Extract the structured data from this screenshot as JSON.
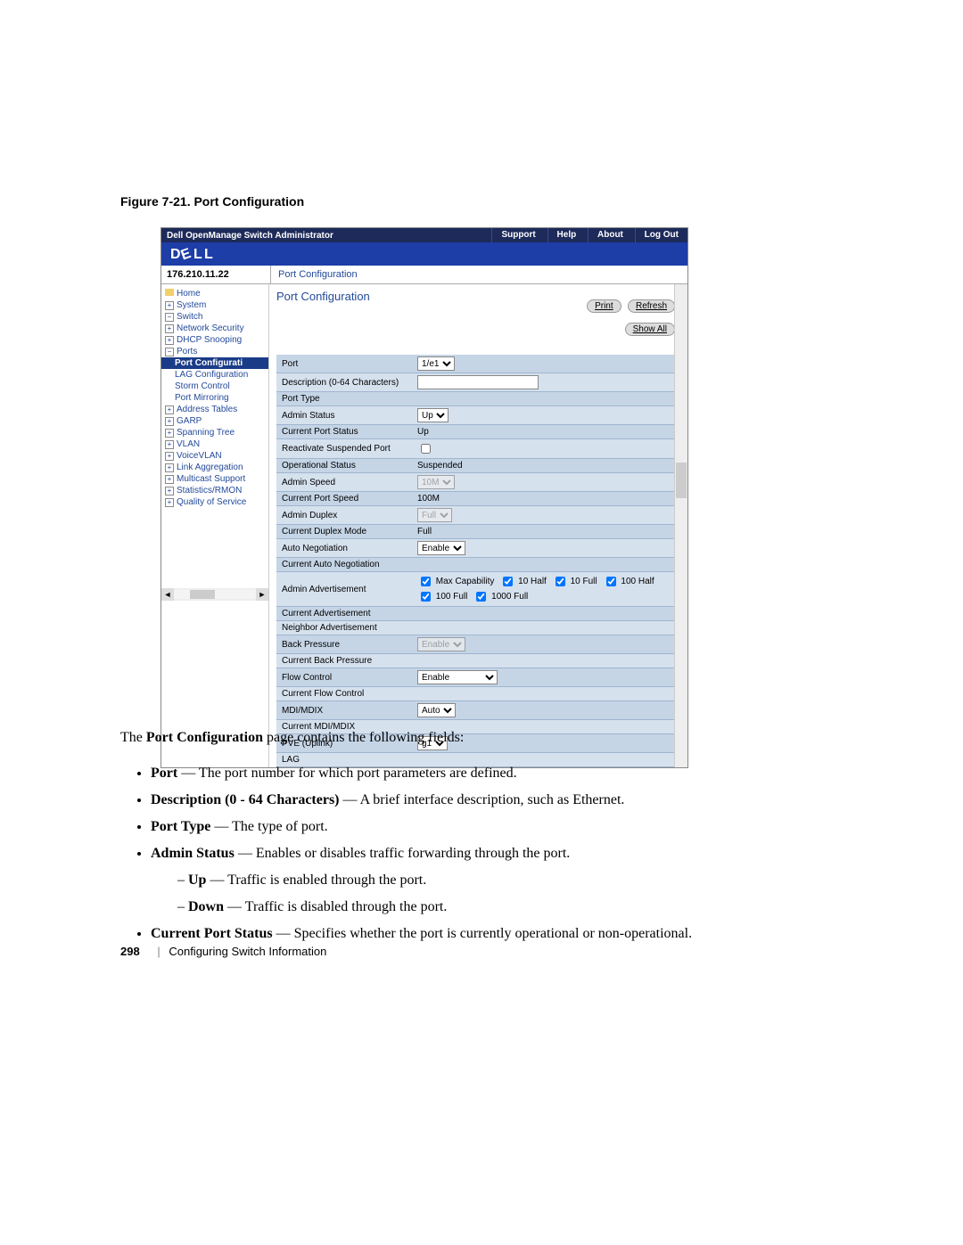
{
  "figure_caption": "Figure 7-21.    Port Configuration",
  "topbar": {
    "title": "Dell OpenManage Switch Administrator",
    "links": [
      "Support",
      "Help",
      "About",
      "Log Out"
    ]
  },
  "ip": "176.210.11.22",
  "breadcrumb": "Port Configuration",
  "sidebar": {
    "home": "Home",
    "items": [
      {
        "label": "System",
        "level": 1,
        "kind": "parent"
      },
      {
        "label": "Switch",
        "level": 1,
        "kind": "parent open"
      },
      {
        "label": "Network Security",
        "level": 2,
        "kind": "parent"
      },
      {
        "label": "DHCP Snooping",
        "level": 2,
        "kind": "parent"
      },
      {
        "label": "Ports",
        "level": 2,
        "kind": "parent open"
      },
      {
        "label": "Port Configurati",
        "level": 3,
        "kind": "leaf sel"
      },
      {
        "label": "LAG Configuration",
        "level": 3,
        "kind": "leaf"
      },
      {
        "label": "Storm Control",
        "level": 3,
        "kind": "leaf"
      },
      {
        "label": "Port Mirroring",
        "level": 3,
        "kind": "leaf"
      },
      {
        "label": "Address Tables",
        "level": 2,
        "kind": "parent"
      },
      {
        "label": "GARP",
        "level": 2,
        "kind": "parent"
      },
      {
        "label": "Spanning Tree",
        "level": 2,
        "kind": "parent"
      },
      {
        "label": "VLAN",
        "level": 2,
        "kind": "parent"
      },
      {
        "label": "VoiceVLAN",
        "level": 2,
        "kind": "parent"
      },
      {
        "label": "Link Aggregation",
        "level": 2,
        "kind": "parent"
      },
      {
        "label": "Multicast Support",
        "level": 2,
        "kind": "parent"
      },
      {
        "label": "Statistics/RMON",
        "level": 1,
        "kind": "parent"
      },
      {
        "label": "Quality of Service",
        "level": 1,
        "kind": "parent"
      }
    ]
  },
  "content": {
    "heading": "Port Configuration",
    "buttons": {
      "print": "Print",
      "refresh": "Refresh",
      "showall": "Show All"
    },
    "rows": [
      {
        "label": "Port",
        "ctrl": "select",
        "value": "1/e1"
      },
      {
        "label": "Description (0-64 Characters)",
        "ctrl": "text",
        "value": ""
      },
      {
        "label": "Port Type",
        "ctrl": "static",
        "value": ""
      },
      {
        "label": "Admin Status",
        "ctrl": "select",
        "value": "Up"
      },
      {
        "label": "Current Port Status",
        "ctrl": "static",
        "value": "Up"
      },
      {
        "label": "Reactivate Suspended Port",
        "ctrl": "checkbox",
        "value": ""
      },
      {
        "label": "Operational Status",
        "ctrl": "static",
        "value": "Suspended"
      },
      {
        "label": "Admin Speed",
        "ctrl": "select-disabled",
        "value": "10M"
      },
      {
        "label": "Current Port Speed",
        "ctrl": "static",
        "value": "100M"
      },
      {
        "label": "Admin Duplex",
        "ctrl": "select-disabled",
        "value": "Full"
      },
      {
        "label": "Current Duplex Mode",
        "ctrl": "static",
        "value": "Full"
      },
      {
        "label": "Auto Negotiation",
        "ctrl": "select",
        "value": "Enable"
      },
      {
        "label": "Current Auto Negotiation",
        "ctrl": "static",
        "value": ""
      },
      {
        "label": "Admin Advertisement",
        "ctrl": "checkgroup",
        "value": ""
      },
      {
        "label": "Current Advertisement",
        "ctrl": "static",
        "value": ""
      },
      {
        "label": "Neighbor Advertisement",
        "ctrl": "static",
        "value": ""
      },
      {
        "label": "Back Pressure",
        "ctrl": "select-disabled",
        "value": "Enable"
      },
      {
        "label": "Current Back Pressure",
        "ctrl": "static",
        "value": ""
      },
      {
        "label": "Flow Control",
        "ctrl": "select-wide",
        "value": "Enable"
      },
      {
        "label": "Current Flow Control",
        "ctrl": "static",
        "value": ""
      },
      {
        "label": "MDI/MDIX",
        "ctrl": "select",
        "value": "Auto"
      },
      {
        "label": "Current MDI/MDIX",
        "ctrl": "static",
        "value": ""
      },
      {
        "label": "PVE (Uplink)",
        "ctrl": "select",
        "value": "g1"
      },
      {
        "label": "LAG",
        "ctrl": "static",
        "value": ""
      }
    ],
    "advert_opts": [
      "Max Capability",
      "10 Half",
      "10 Full",
      "100 Half",
      "100 Full",
      "1000 Full"
    ]
  },
  "body": {
    "intro_pre": "The ",
    "intro_bold": "Port Configuration",
    "intro_post": " page contains the following fields:",
    "bullets": [
      {
        "b": "Port",
        "t": " — The port number for which port parameters are defined."
      },
      {
        "b": "Description (0 - 64 Characters)",
        "t": " — A brief interface description, such as Ethernet."
      },
      {
        "b": "Port Type",
        "t": " — The type of port."
      },
      {
        "b": "Admin Status",
        "t": " — Enables or disables traffic forwarding through the port.",
        "sub": [
          {
            "b": "Up",
            "t": " — Traffic is enabled through the port."
          },
          {
            "b": "Down",
            "t": " — Traffic is disabled through the port."
          }
        ]
      },
      {
        "b": "Current Port Status",
        "t": " — Specifies whether the port is currently operational or non-operational."
      }
    ]
  },
  "footer": {
    "page": "298",
    "section": "Configuring Switch Information"
  }
}
